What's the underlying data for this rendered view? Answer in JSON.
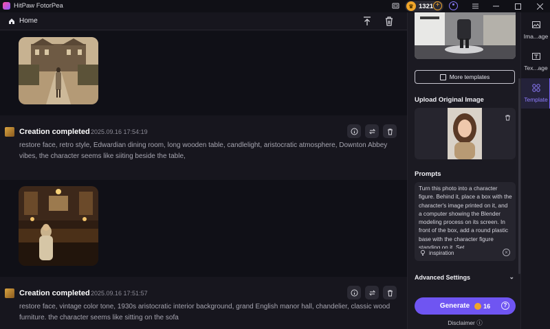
{
  "app": {
    "title": "HitPaw FotorPea",
    "credits": "1321"
  },
  "topbar": {
    "home_label": "Home"
  },
  "entries": [
    {
      "title": "Creation completed",
      "time": "2025.09.16    17:54:19",
      "prompt": "restore face, retro style, Edwardian dining room, long wooden table, candlelight, aristocratic atmosphere, Downton Abbey vibes, the character seems like siiting beside the table,"
    },
    {
      "title": "Creation completed",
      "time": "2025.09.16    17:51:57",
      "prompt": "restore face, vintage color tone, 1930s aristocratic interior background, grand English manor hall, chandelier, classic wood furniture.  the character seems like sitting on the sofa"
    }
  ],
  "side": {
    "more_templates": "More templates",
    "upload_title": "Upload Original Image",
    "prompts_title": "Prompts",
    "prompt_text": "Turn this photo into a character figure. Behind it, place a box with the character's image printed on it, and a computer showing the Blender modeling process on its screen. In front of the box, add a round plastic base with the character figure standing on it. Set",
    "inspiration": "inspiration",
    "advanced": "Advanced Settings",
    "generate": "Generate",
    "generate_cost": "16",
    "disclaimer": "Disclaimer"
  },
  "rail": [
    {
      "label": "Ima...age"
    },
    {
      "label": "Tex...age"
    },
    {
      "label": "Template"
    }
  ],
  "colors": {
    "accent": "#6f55f2",
    "coin": "#f0a52a",
    "background": "#17161e"
  }
}
